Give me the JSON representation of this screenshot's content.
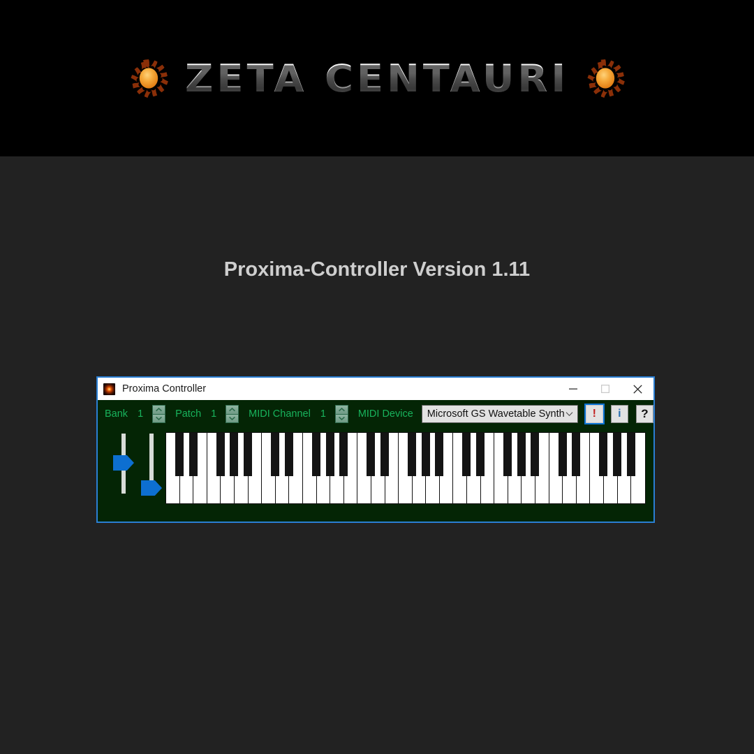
{
  "banner": {
    "brand": "ZETA CENTAURI",
    "left_logo": "sun-icon",
    "right_logo": "sun-icon"
  },
  "page": {
    "version_title": "Proxima-Controller Version 1.11",
    "background_color": "#222222",
    "banner_color": "#000000"
  },
  "window": {
    "title": "Proxima Controller",
    "icon": "proxima-star-icon",
    "border_color": "#2a7fd4",
    "body_color": "#042505",
    "controls": {
      "minimize": "minimize-icon",
      "maximize": "maximize-icon",
      "close": "close-icon"
    }
  },
  "toolbar": {
    "accent_color": "#18b35c",
    "bank": {
      "label": "Bank",
      "value": "1"
    },
    "patch": {
      "label": "Patch",
      "value": "1"
    },
    "midi_channel": {
      "label": "MIDI Channel",
      "value": "1"
    },
    "midi_device": {
      "label": "MIDI Device",
      "selected": "Microsoft GS Wavetable Synth"
    },
    "buttons": {
      "panic": "!",
      "info": "i",
      "help": "?"
    }
  },
  "panel": {
    "pitch_slider": {
      "name": "pitch-bend-slider",
      "value_position": "middle"
    },
    "mod_slider": {
      "name": "modulation-slider",
      "value_position": "lower"
    },
    "keyboard": {
      "white_keys": 35,
      "octaves": 5,
      "start_note": "C"
    }
  }
}
